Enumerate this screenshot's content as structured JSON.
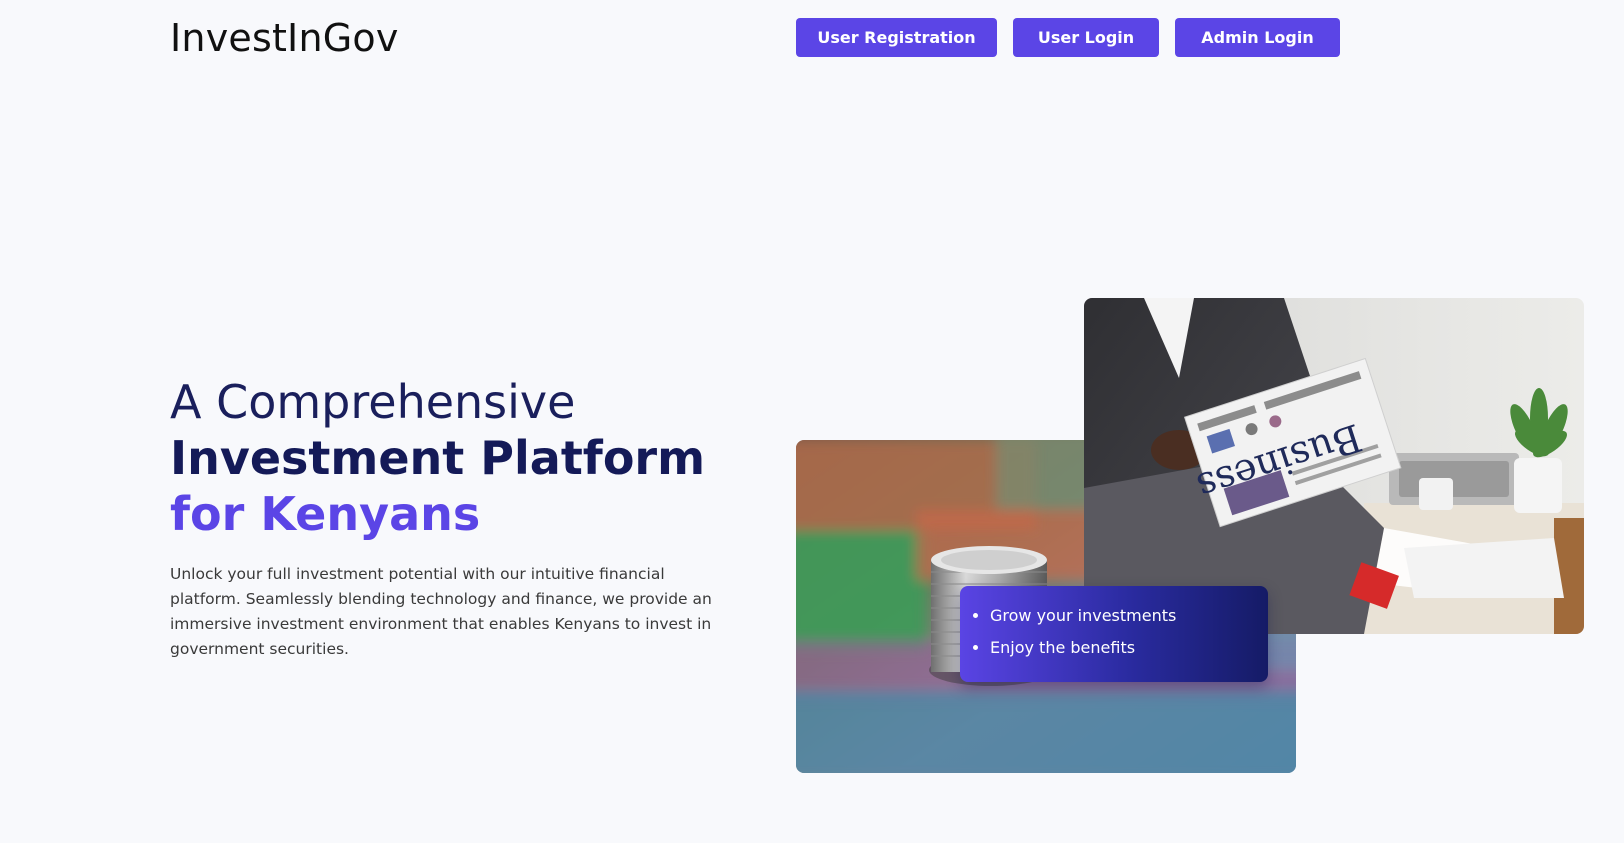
{
  "header": {
    "brand": "InvestInGov",
    "nav": {
      "user_registration": "User Registration",
      "user_login": "User Login",
      "admin_login": "Admin Login"
    }
  },
  "hero": {
    "line1": "A Comprehensive",
    "line2": "Investment Platform",
    "line3": "for Kenyans",
    "description": "Unlock your full investment potential with our intuitive financial platform. Seamlessly blending technology and finance, we provide an immersive investment environment that enables Kenyans to invest in government securities."
  },
  "features": {
    "items": [
      "Grow your investments",
      "Enjoy the benefits"
    ]
  },
  "images": {
    "newspaper_text": "Business"
  },
  "colors": {
    "accent": "#5b45e6",
    "heading_dark": "#141a58",
    "background": "#f8f9fc"
  }
}
